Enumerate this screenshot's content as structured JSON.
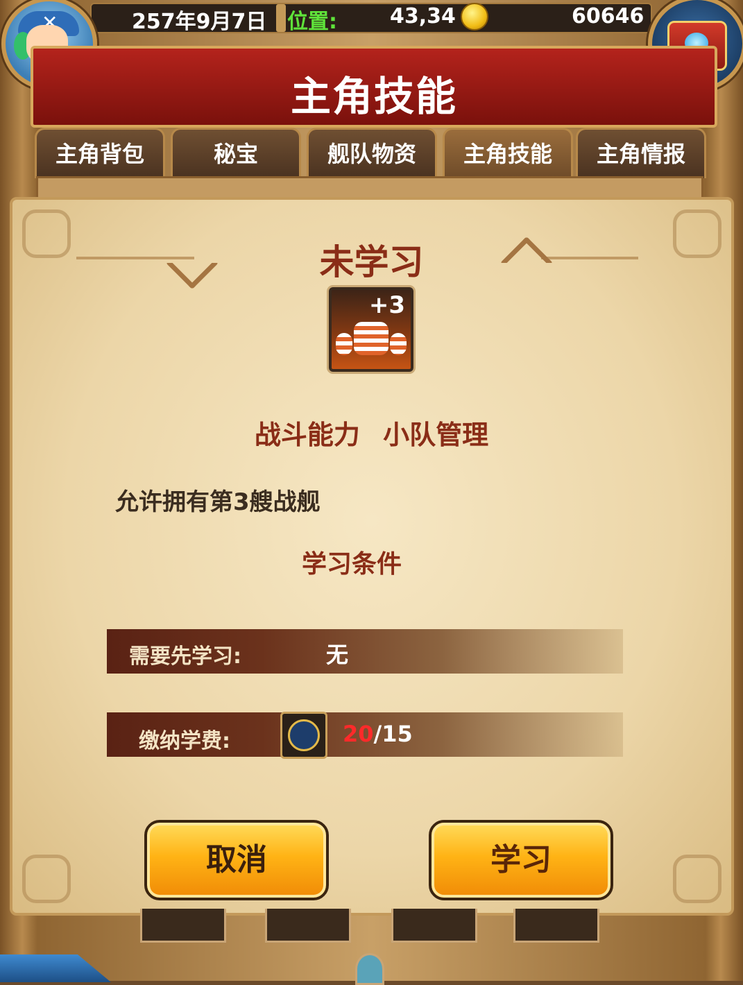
{
  "status_bar": {
    "date": "257年9月7日",
    "position_label": "位置:",
    "position_value": "43,34",
    "gold": "60646"
  },
  "avatar": {
    "mark": "✕"
  },
  "title": "主角技能",
  "tabs": [
    {
      "label": "主角背包"
    },
    {
      "label": "秘宝"
    },
    {
      "label": "舰队物资"
    },
    {
      "label": "主角技能",
      "active": true
    },
    {
      "label": "主角情报"
    }
  ],
  "skill": {
    "status": "未学习",
    "icon_badge": "+3",
    "name": "战斗能力 小队管理",
    "description": "允许拥有第3艘战舰",
    "conditions_title": "学习条件",
    "prerequisite_label": "需要先学习:",
    "prerequisite_value": "无",
    "fee_label": "缴纳学费:",
    "fee_have": "20",
    "fee_need": "/15"
  },
  "buttons": {
    "cancel": "取消",
    "learn": "学习"
  },
  "colors": {
    "banner": "#b4231c",
    "status_text": "#8a2d17",
    "position_label": "#5fe33a",
    "fee_have": "#ff2a2a",
    "button": "#ffb315"
  }
}
